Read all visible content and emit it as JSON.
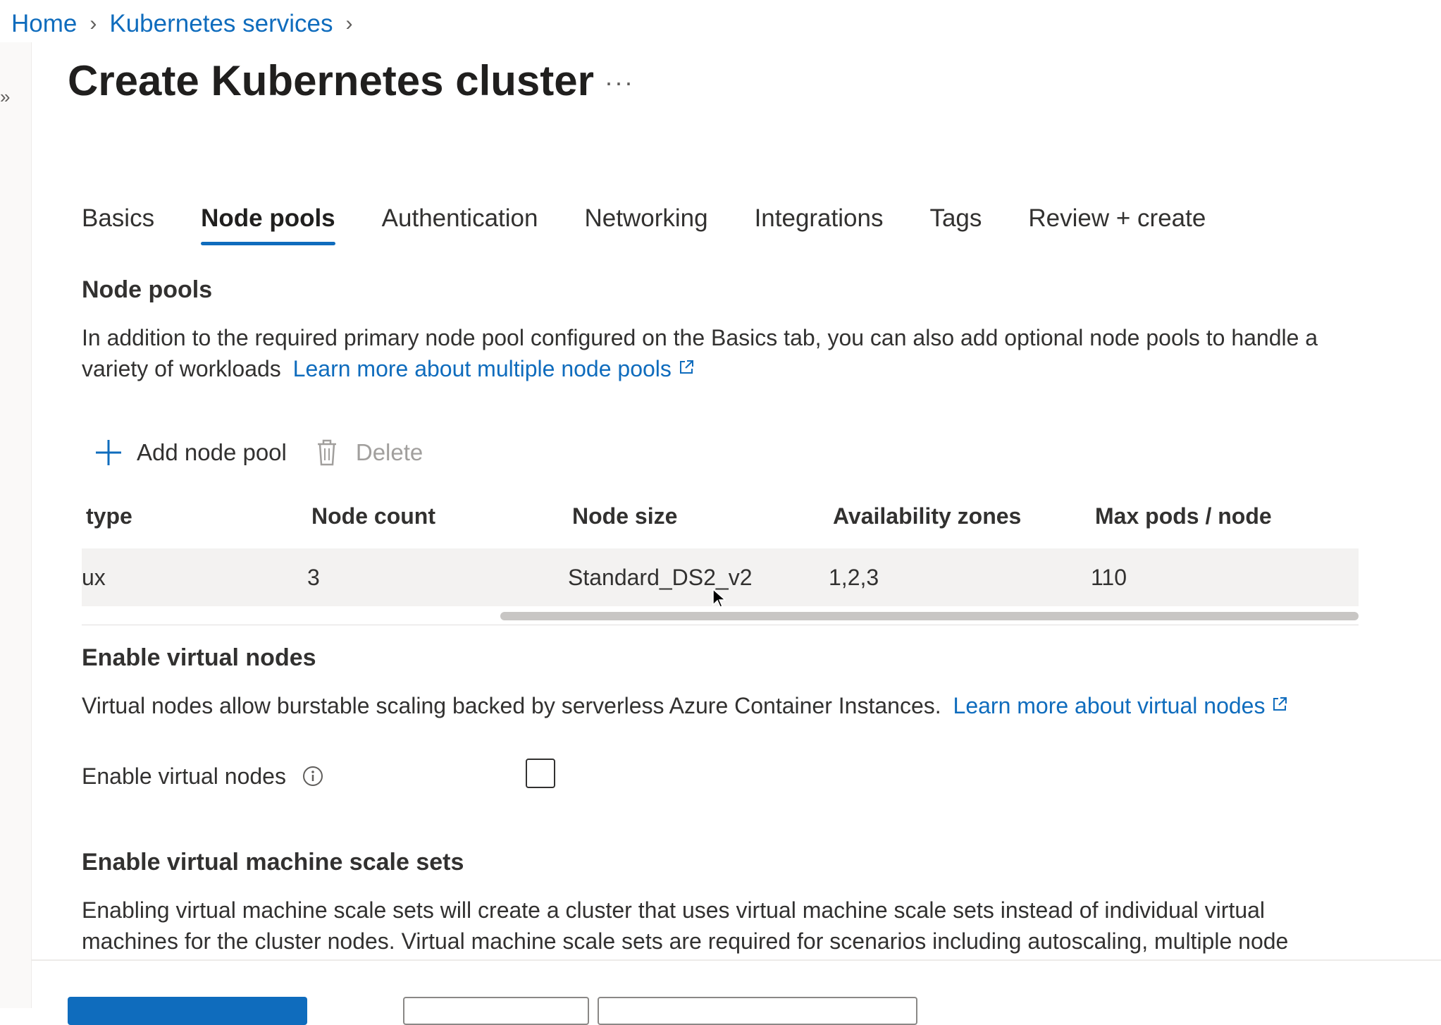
{
  "breadcrumb": {
    "home": "Home",
    "service": "Kubernetes services"
  },
  "header": {
    "title": "Create Kubernetes cluster",
    "more": "···"
  },
  "tabs": [
    {
      "label": "Basics"
    },
    {
      "label": "Node pools",
      "active": true
    },
    {
      "label": "Authentication"
    },
    {
      "label": "Networking"
    },
    {
      "label": "Integrations"
    },
    {
      "label": "Tags"
    },
    {
      "label": "Review + create"
    }
  ],
  "node_pools": {
    "title": "Node pools",
    "description": "In addition to the required primary node pool configured on the Basics tab, you can also add optional node pools to handle a variety of workloads",
    "learn_more": "Learn more about multiple node pools"
  },
  "toolbar": {
    "add_label": "Add node pool",
    "delete_label": "Delete"
  },
  "table": {
    "headers": [
      "type",
      "Node count",
      "Node size",
      "Availability zones",
      "Max pods / node"
    ],
    "rows": [
      {
        "type": "ux",
        "count": "3",
        "size": "Standard_DS2_v2",
        "zones": "1,2,3",
        "max_pods": "110"
      }
    ]
  },
  "virtual_nodes": {
    "title": "Enable virtual nodes",
    "description": "Virtual nodes allow burstable scaling backed by serverless Azure Container Instances.",
    "learn_more": "Learn more about virtual nodes",
    "field_label": "Enable virtual nodes",
    "checked": false
  },
  "vmss": {
    "title": "Enable virtual machine scale sets",
    "description": "Enabling virtual machine scale sets will create a cluster that uses virtual machine scale sets instead of individual virtual machines for the cluster nodes. Virtual machine scale sets are required for scenarios including autoscaling, multiple node"
  },
  "colors": {
    "accent": "#0f6cbd",
    "text": "#323130",
    "row_bg": "#f3f2f1"
  },
  "icons": {
    "add": "plus-icon",
    "delete": "trash-icon",
    "info": "info-icon",
    "external": "external-link-icon",
    "expand": "double-chevron-right-icon"
  }
}
